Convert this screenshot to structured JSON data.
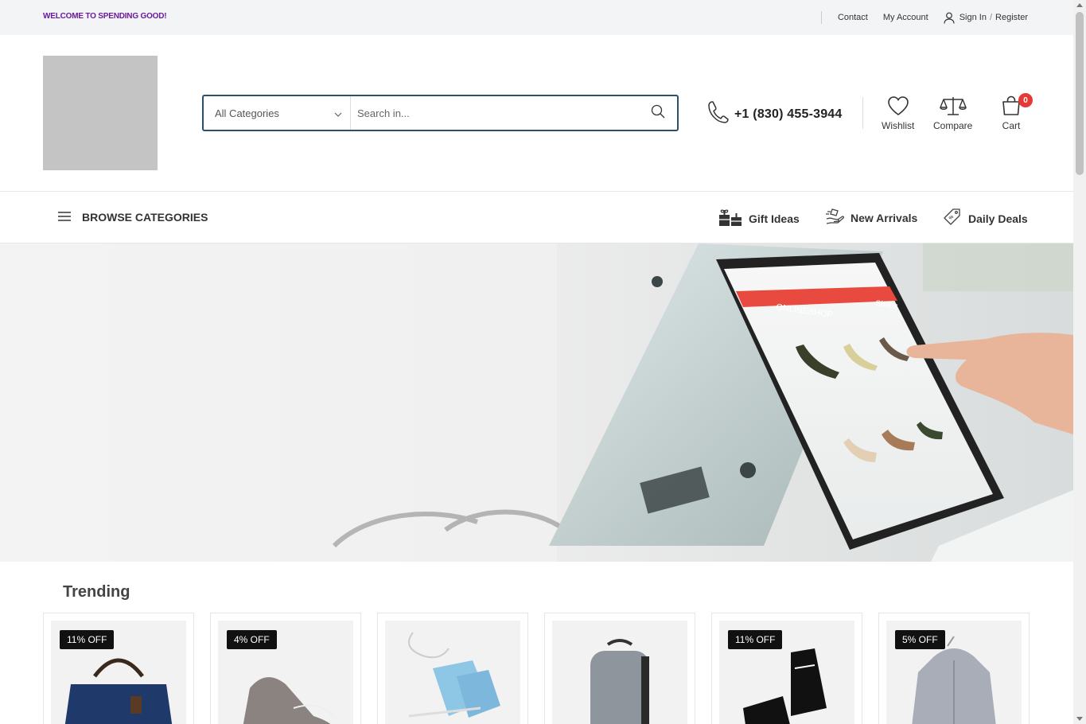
{
  "topbar": {
    "welcome": "WELCOME TO SPENDING GOOD!",
    "links": [
      "Contact",
      "My Account"
    ],
    "signin": "Sign In",
    "slash": "/",
    "register": "Register"
  },
  "header": {
    "categories_select": "All Categories",
    "search_placeholder": "Search in...",
    "phone": "+1 (830) 455-3944",
    "wishlist": "Wishlist",
    "compare": "Compare",
    "cart": "Cart",
    "cart_count": "0"
  },
  "nav": {
    "browse": "BROWSE CATEGORIES",
    "items": [
      "Gift Ideas",
      "New Arrivals",
      "Daily Deals"
    ]
  },
  "hero": {
    "screen_brand": "ONLINESHOP",
    "screen_tab": "Shoes"
  },
  "trending": {
    "title": "Trending",
    "products": [
      {
        "badge": "11% OFF",
        "image": "navy-duffel-bag"
      },
      {
        "badge": "4% OFF",
        "image": "grey-sneaker"
      },
      {
        "badge": "",
        "image": "blue-ice-skates"
      },
      {
        "badge": "",
        "image": "grey-backpack"
      },
      {
        "badge": "11% OFF",
        "image": "black-hockey-skates"
      },
      {
        "badge": "5% OFF",
        "image": "grey-hoodie"
      }
    ]
  },
  "colors": {
    "accent": "#6a1b9a",
    "search_border": "#2c4f6b",
    "badge_red": "#e53935",
    "badge_dark": "#111111"
  }
}
